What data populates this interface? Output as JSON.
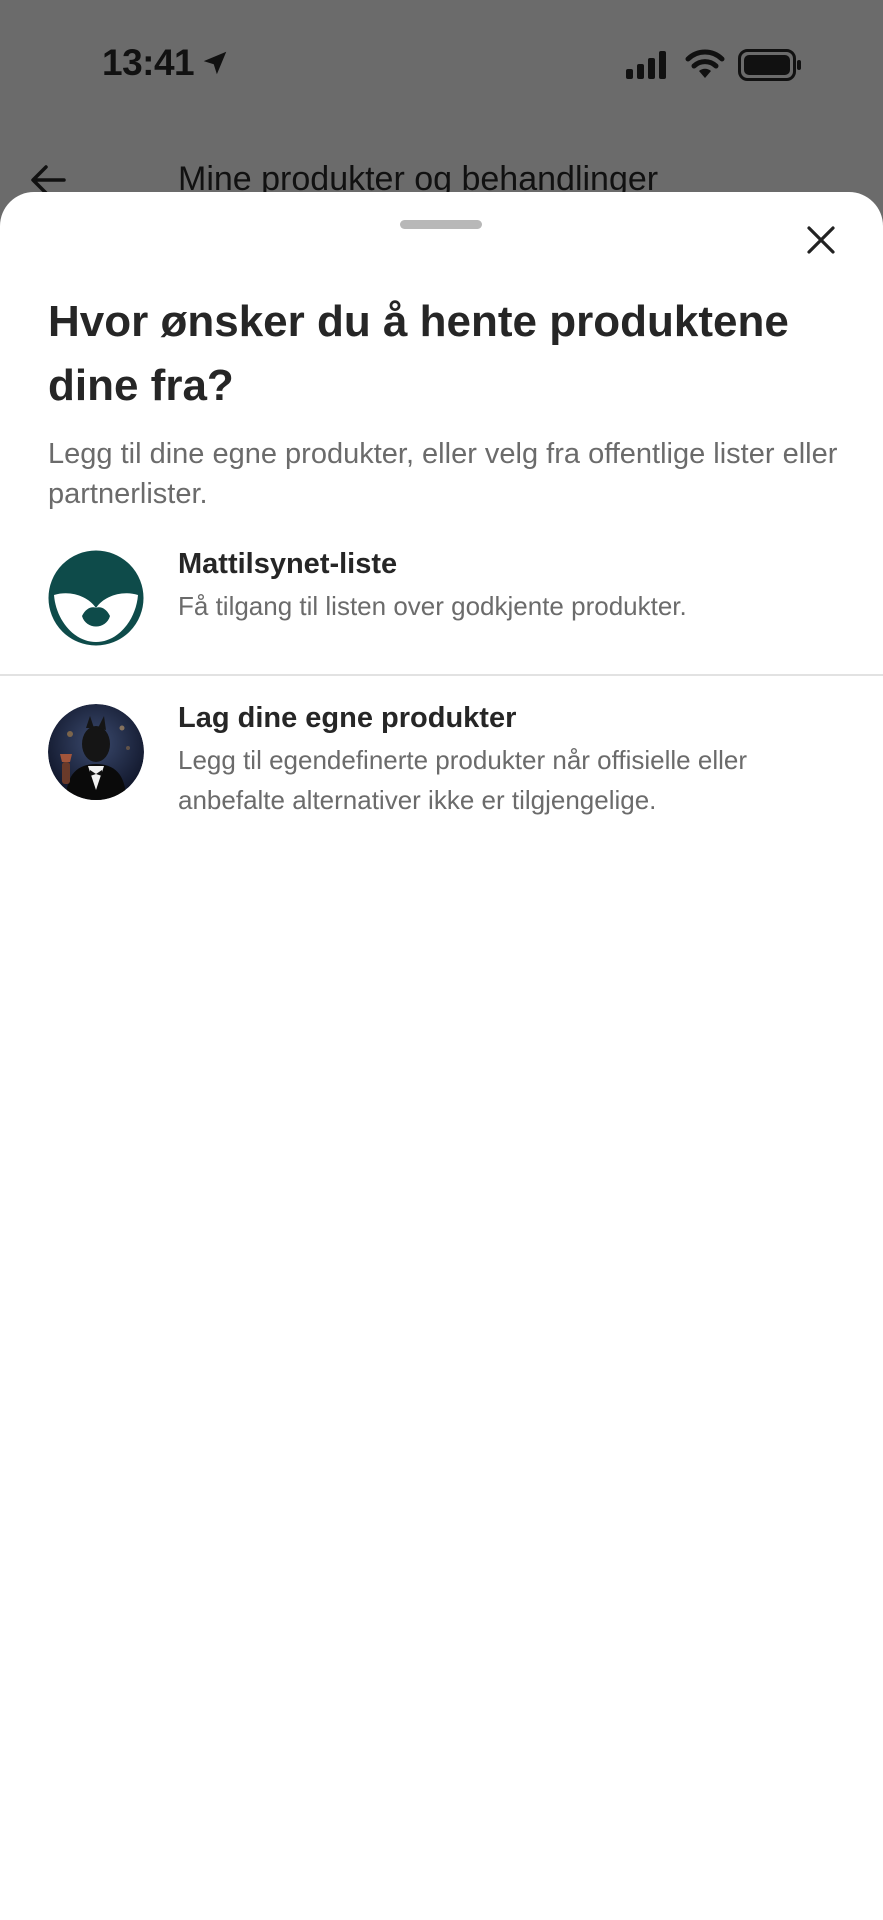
{
  "status_bar": {
    "time": "13:41"
  },
  "background_screen": {
    "title": "Mine produkter og behandlinger"
  },
  "sheet": {
    "title": "Hvor ønsker du å hente produktene dine fra?",
    "subtitle": "Legg til dine egne produkter, eller velg fra offentlige lister eller partnerlister.",
    "options": [
      {
        "title": "Mattilsynet-liste",
        "description": "Få tilgang til listen over godkjente produkter.",
        "icon": "mattilsynet-logo-icon"
      },
      {
        "title": "Lag dine egne produkter",
        "description": "Legg til egendefinerte produkter når offisielle eller anbefalte alternativer ikke er tilgjengelige.",
        "icon": "custom-products-avatar"
      }
    ]
  },
  "colors": {
    "accent": "#0e4b4a",
    "backdrop": "#6b6b6b",
    "text_primary": "#262626",
    "text_secondary": "#6b6b6b"
  }
}
